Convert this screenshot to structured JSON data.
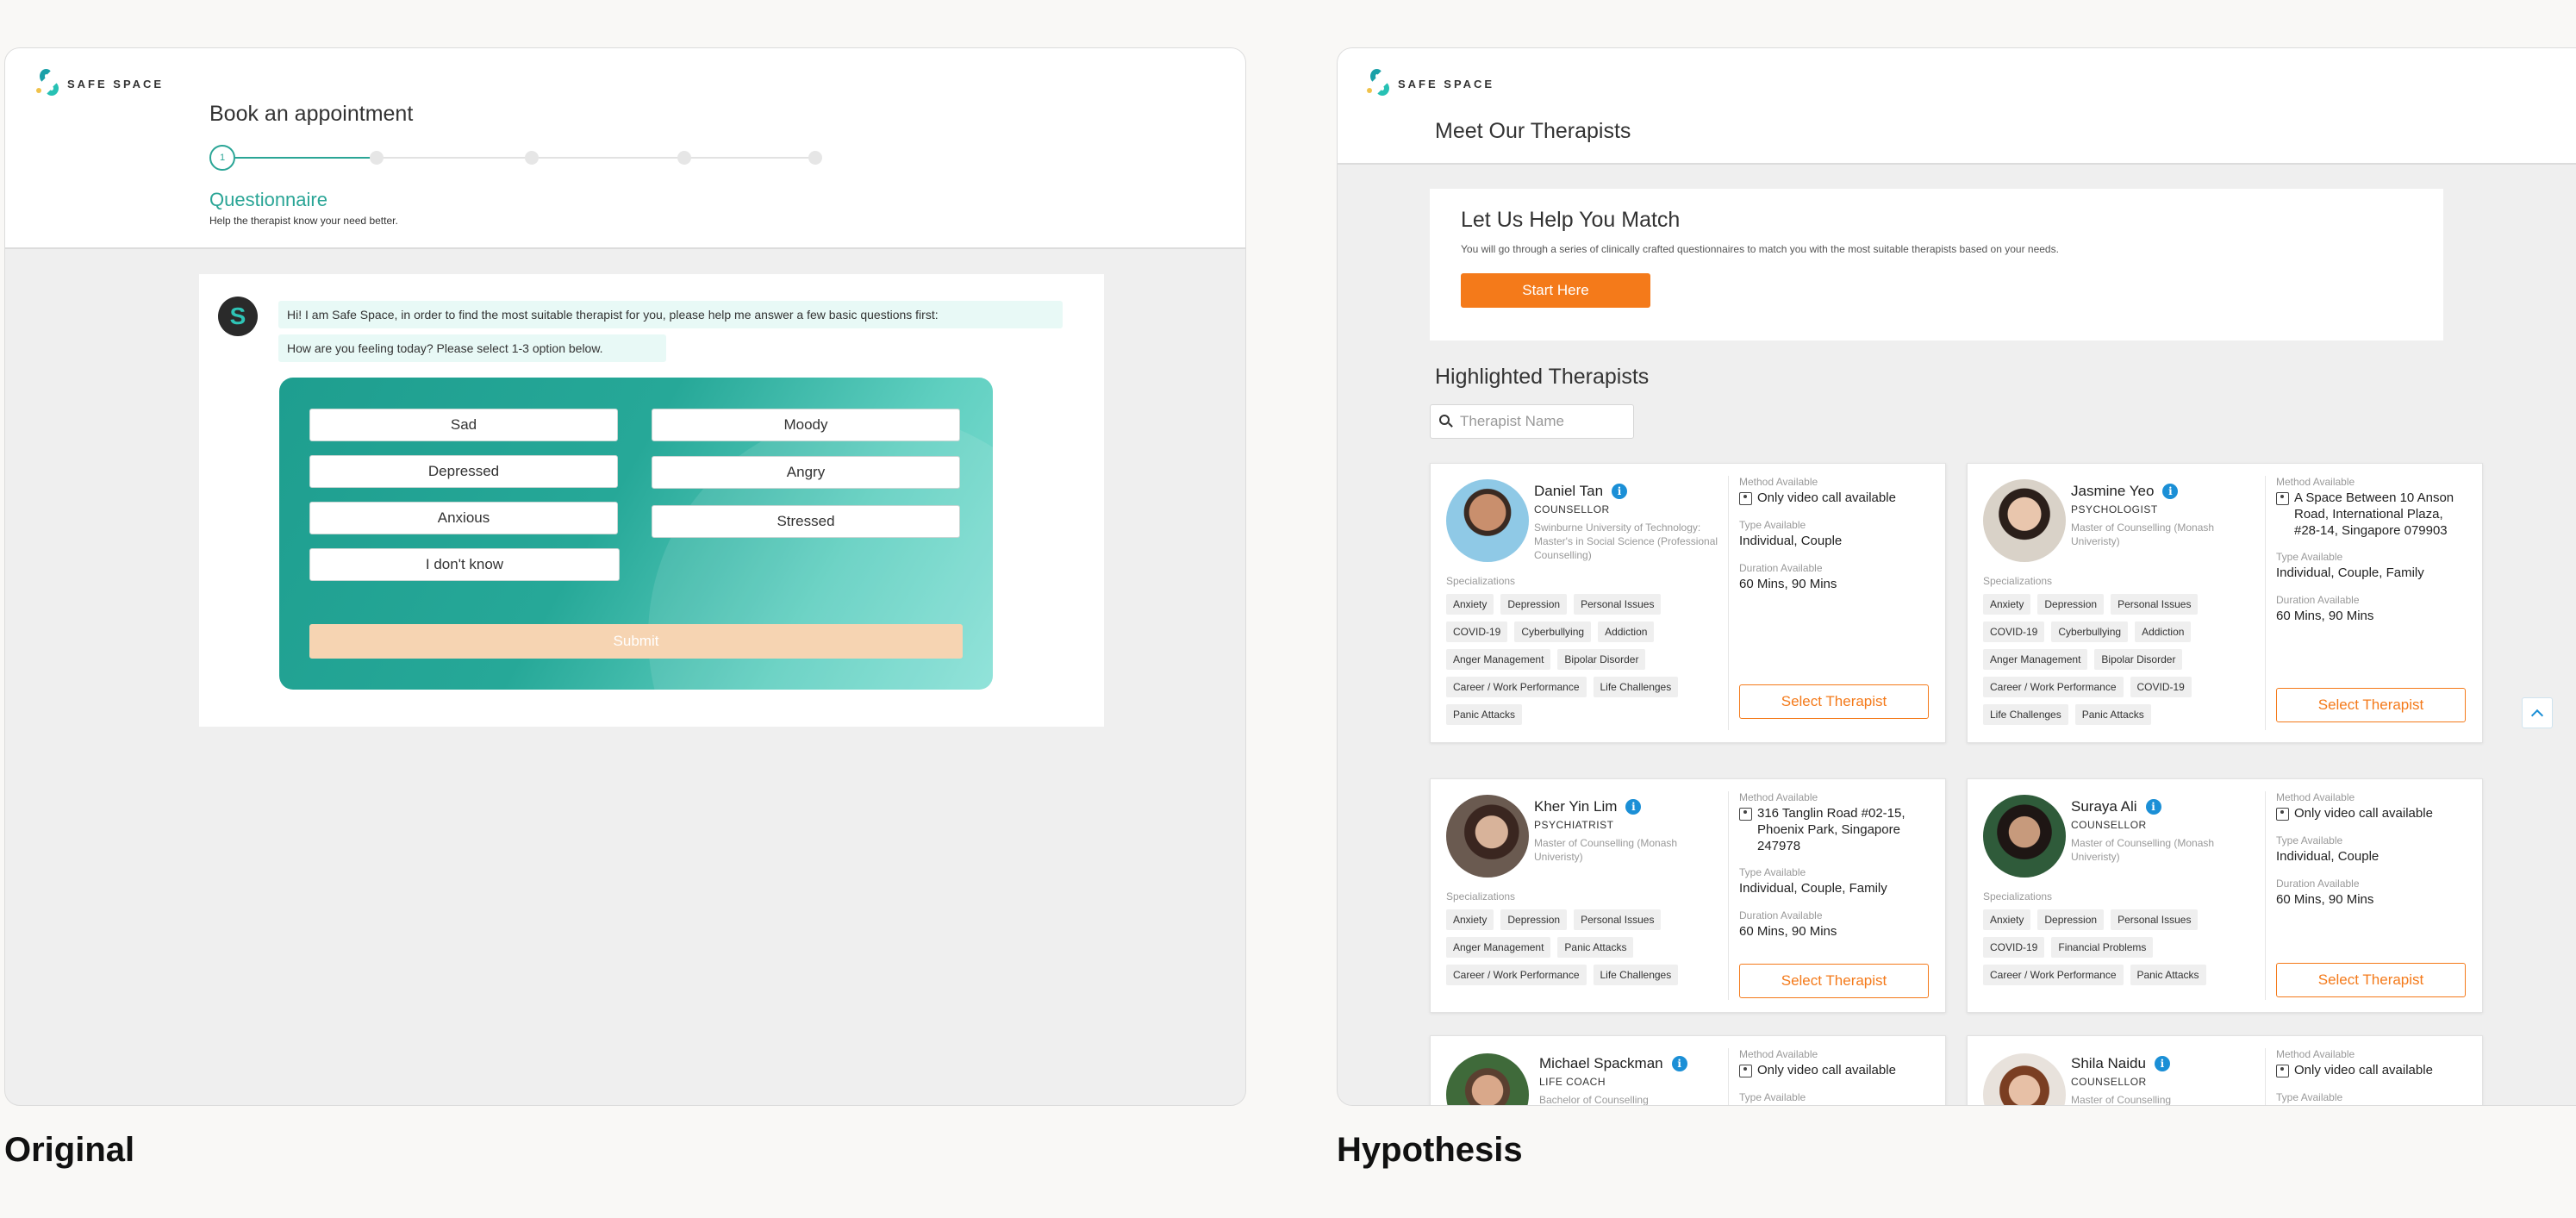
{
  "captions": {
    "left": "Original",
    "right": "Hypothesis"
  },
  "brand": {
    "name": "SAFE SPACE",
    "accent": "#2aa596",
    "orange": "#f47a1a"
  },
  "original": {
    "title": "Book an appointment",
    "stepper": {
      "current": "1",
      "total_steps": 5
    },
    "section_title": "Questionnaire",
    "section_desc": "Help the therapist know your need better.",
    "chat": {
      "avatar_letter": "S",
      "message_1": "Hi! I am Safe Space, in order to find the most suitable therapist for you, please help me answer a few basic questions first:",
      "message_2": "How are you feeling today? Please select 1-3 option below."
    },
    "options": [
      "Sad",
      "Moody",
      "Depressed",
      "Angry",
      "Anxious",
      "Stressed",
      "I don't know"
    ],
    "submit_label": "Submit"
  },
  "hypothesis": {
    "title": "Meet Our Therapists",
    "match": {
      "title": "Let Us Help You Match",
      "desc": "You will go through a series of clinically crafted questionnaires to match you with the most suitable therapists based on your needs.",
      "button": "Start Here"
    },
    "highlighted_title": "Highlighted Therapists",
    "search_placeholder": "Therapist Name",
    "labels": {
      "method": "Method Available",
      "type": "Type Available",
      "duration": "Duration Available",
      "specializations": "Specializations",
      "select": "Select Therapist"
    },
    "therapists": [
      {
        "name": "Daniel Tan",
        "role": "COUNSELLOR",
        "education": "Swinburne University of Technology: Master's in Social Science (Professional Counselling)",
        "tags": [
          "Anxiety",
          "Depression",
          "Personal Issues",
          "COVID-19",
          "Cyberbullying",
          "Addiction",
          "Anger Management",
          "Bipolar Disorder",
          "Career / Work Performance",
          "Life Challenges",
          "Panic Attacks"
        ],
        "method": "Only video call available",
        "type": "Individual, Couple",
        "duration": "60 Mins, 90 Mins"
      },
      {
        "name": "Jasmine Yeo",
        "role": "PSYCHOLOGIST",
        "education": "Master of Counselling (Monash Univeristy)",
        "tags": [
          "Anxiety",
          "Depression",
          "Personal Issues",
          "COVID-19",
          "Cyberbullying",
          "Addiction",
          "Anger Management",
          "Bipolar Disorder",
          "Career / Work Performance",
          "COVID-19",
          "Life Challenges",
          "Panic Attacks"
        ],
        "method": "A Space Between 10 Anson Road, International Plaza, #28-14, Singapore 079903",
        "type": "Individual, Couple, Family",
        "duration": "60 Mins, 90 Mins"
      },
      {
        "name": "Kher Yin Lim",
        "role": "PSYCHIATRIST",
        "education": "Master of Counselling (Monash Univeristy)",
        "tags": [
          "Anxiety",
          "Depression",
          "Personal Issues",
          "Anger Management",
          "Panic Attacks",
          "Career / Work Performance",
          "Life Challenges"
        ],
        "method": "316 Tanglin Road #02-15, Phoenix Park, Singapore 247978",
        "type": "Individual, Couple, Family",
        "duration": "60 Mins, 90 Mins"
      },
      {
        "name": "Suraya Ali",
        "role": "COUNSELLOR",
        "education": "Master of Counselling (Monash Univeristy)",
        "tags": [
          "Anxiety",
          "Depression",
          "Personal Issues",
          "COVID-19",
          "Financial Problems",
          "Career / Work Performance",
          "Panic Attacks"
        ],
        "method": "Only video call available",
        "type": "Individual, Couple",
        "duration": "60 Mins, 90 Mins"
      },
      {
        "name": "Michael Spackman",
        "role": "LIFE COACH",
        "education": "Bachelor of Counselling",
        "tags": [],
        "method": "Only video call available",
        "type": "",
        "duration": ""
      },
      {
        "name": "Shila Naidu",
        "role": "COUNSELLOR",
        "education": "Master of Counselling",
        "tags": [],
        "method": "Only video call available",
        "type": "",
        "duration": ""
      }
    ]
  }
}
